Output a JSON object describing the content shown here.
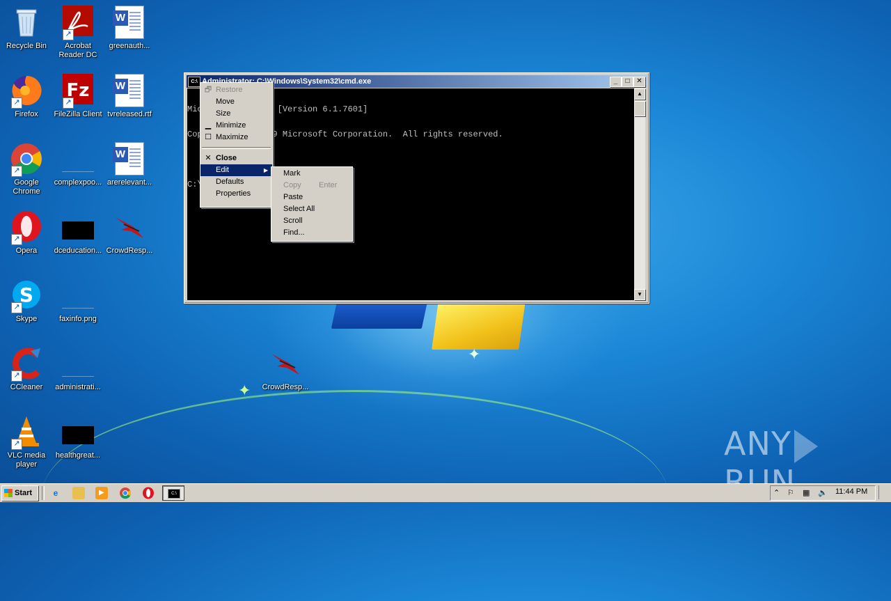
{
  "desktop": {
    "icons": [
      {
        "label": "Recycle Bin",
        "icon": "recycle-bin-icon"
      },
      {
        "label": "Acrobat Reader DC",
        "icon": "acrobat-icon"
      },
      {
        "label": "greenauth...",
        "icon": "word-document-icon"
      },
      {
        "label": "Firefox",
        "icon": "firefox-icon"
      },
      {
        "label": "FileZilla Client",
        "icon": "filezilla-icon"
      },
      {
        "label": "tvreleased.rtf",
        "icon": "word-document-icon"
      },
      {
        "label": "Google Chrome",
        "icon": "chrome-icon"
      },
      {
        "label": "complexpoo...",
        "icon": "file-icon"
      },
      {
        "label": "arerelevant...",
        "icon": "word-document-icon"
      },
      {
        "label": "Opera",
        "icon": "opera-icon"
      },
      {
        "label": "dceducation...",
        "icon": "image-file-icon"
      },
      {
        "label": "CrowdResp...",
        "icon": "crowdresponse-icon"
      },
      {
        "label": "Skype",
        "icon": "skype-icon"
      },
      {
        "label": "faxinfo.png",
        "icon": "file-icon"
      },
      {
        "label": "CCleaner",
        "icon": "ccleaner-icon"
      },
      {
        "label": "administrati...",
        "icon": "file-icon"
      },
      {
        "label": "VLC media player",
        "icon": "vlc-icon"
      },
      {
        "label": "healthgreat...",
        "icon": "image-file-icon"
      },
      {
        "label": "CrowdResp...",
        "icon": "crowdresponse-icon"
      }
    ]
  },
  "cmd_window": {
    "title": "Administrator: C:\\Windows\\System32\\cmd.exe",
    "console_lines": [
      "Microsoft Windows [Version 6.1.7601]",
      "Copyright (c) 2009 Microsoft Corporation.  All rights reserved.",
      "",
      "C:\\Windows\\system32>_"
    ]
  },
  "system_menu": {
    "items": [
      {
        "label": "Restore",
        "disabled": true
      },
      {
        "label": "Move"
      },
      {
        "label": "Size"
      },
      {
        "label": "Minimize"
      },
      {
        "label": "Maximize"
      },
      {
        "label": "Close"
      },
      {
        "label": "Edit",
        "selected": true
      },
      {
        "label": "Defaults"
      },
      {
        "label": "Properties"
      }
    ]
  },
  "edit_submenu": {
    "items": [
      {
        "label": "Mark"
      },
      {
        "label": "Copy",
        "accelerator": "Enter",
        "disabled": true
      },
      {
        "label": "Paste"
      },
      {
        "label": "Select All"
      },
      {
        "label": "Scroll"
      },
      {
        "label": "Find..."
      }
    ]
  },
  "watermark": {
    "left": "ANY",
    "right": "RUN"
  },
  "taskbar": {
    "start_label": "Start",
    "quick_launch": [
      "ie-icon",
      "explorer-icon",
      "media-player-icon",
      "chrome-icon",
      "opera-icon"
    ],
    "active_task": "cmd-icon",
    "clock": "11:44 PM"
  },
  "colors": {
    "menu_highlight": "#0a246a",
    "console_bg": "#000000",
    "console_fg": "#c0c0c0",
    "classic_face": "#d4d0c8"
  }
}
